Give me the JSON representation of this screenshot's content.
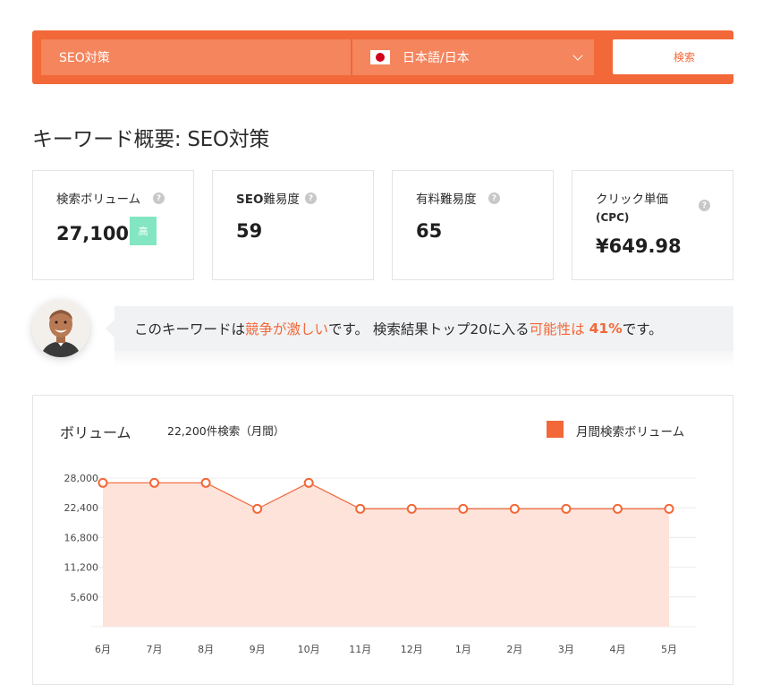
{
  "search": {
    "keyword_value": "SEO対策",
    "language_label": "日本語/日本",
    "flag_icon": "japan-flag-icon",
    "button_label": "検索"
  },
  "overview": {
    "title": "キーワード概要: SEO対策"
  },
  "metrics": [
    {
      "label": "検索ボリューム",
      "value": "27,100",
      "badge": "高"
    },
    {
      "label_bold": "SEO",
      "label": "難易度",
      "value": "59"
    },
    {
      "label": "有料難易度",
      "value": "65"
    },
    {
      "label": "クリック単価",
      "label_sub": "(CPC)",
      "value": "¥649.98"
    }
  ],
  "callout": {
    "p1": "このキーワードは",
    "h1": "競争が激しい",
    "p2": "です。 検索結果トップ20に入る",
    "h2": "可能性は ",
    "h3": "41%",
    "p3": "です。"
  },
  "chart": {
    "title": "ボリューム",
    "subtitle": "22,200件検索（月間）",
    "legend": "月間検索ボリューム"
  },
  "colors": {
    "accent": "#f26838",
    "badge": "#83e6c3",
    "area": "#fde3da"
  },
  "chart_data": {
    "type": "area",
    "categories": [
      "6月",
      "7月",
      "8月",
      "9月",
      "10月",
      "11月",
      "12月",
      "1月",
      "2月",
      "3月",
      "4月",
      "5月"
    ],
    "series": [
      {
        "name": "月間検索ボリューム",
        "values": [
          27100,
          27100,
          27100,
          22200,
          27100,
          22200,
          22200,
          22200,
          22200,
          22200,
          22200,
          22200
        ]
      }
    ],
    "yticks": [
      5600,
      11200,
      16800,
      22400,
      28000
    ],
    "ylim": [
      0,
      28000
    ],
    "title": "ボリューム",
    "grid": true,
    "legend": "top-right"
  }
}
